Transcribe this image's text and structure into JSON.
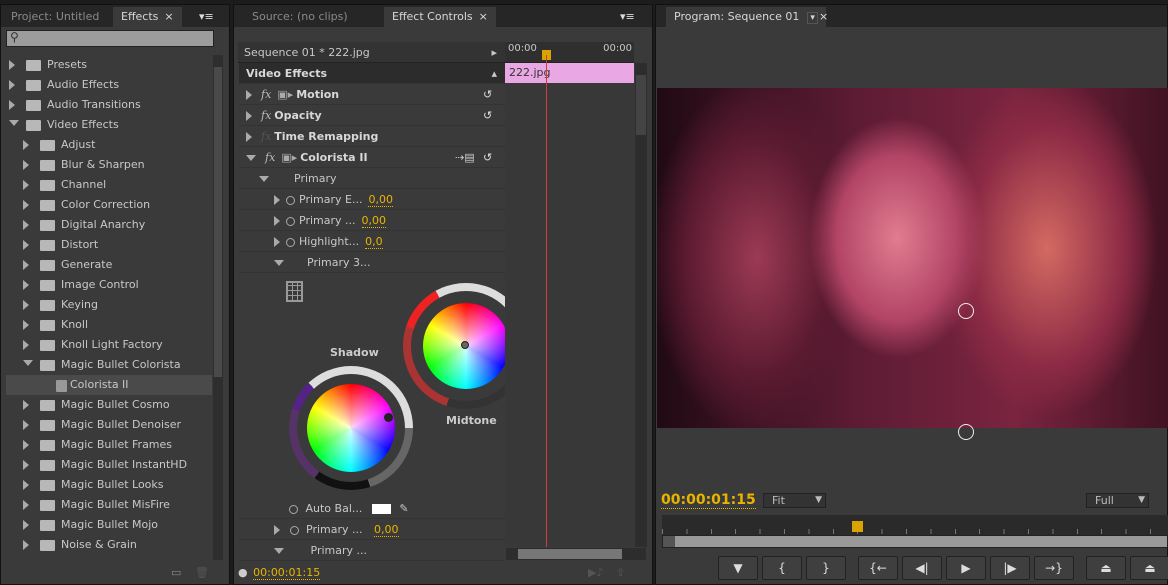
{
  "effects_panel": {
    "tabs": [
      {
        "label": "Project: Untitled"
      },
      {
        "label": "Effects",
        "close": "×"
      }
    ],
    "search_placeholder": "",
    "items": [
      {
        "label": "Presets",
        "level": 0,
        "open": false
      },
      {
        "label": "Audio Effects",
        "level": 0,
        "open": false
      },
      {
        "label": "Audio Transitions",
        "level": 0,
        "open": false
      },
      {
        "label": "Video Effects",
        "level": 0,
        "open": true
      },
      {
        "label": "Adjust",
        "level": 1
      },
      {
        "label": "Blur & Sharpen",
        "level": 1
      },
      {
        "label": "Channel",
        "level": 1
      },
      {
        "label": "Color Correction",
        "level": 1
      },
      {
        "label": "Digital Anarchy",
        "level": 1
      },
      {
        "label": "Distort",
        "level": 1
      },
      {
        "label": "Generate",
        "level": 1
      },
      {
        "label": "Image Control",
        "level": 1
      },
      {
        "label": "Keying",
        "level": 1
      },
      {
        "label": "Knoll",
        "level": 1
      },
      {
        "label": "Knoll Light Factory",
        "level": 1
      },
      {
        "label": "Magic Bullet Colorista",
        "level": 1,
        "open": true
      },
      {
        "label": "Colorista II",
        "level": 2,
        "selected": true
      },
      {
        "label": "Magic Bullet Cosmo",
        "level": 1
      },
      {
        "label": "Magic Bullet Denoiser",
        "level": 1
      },
      {
        "label": "Magic Bullet Frames",
        "level": 1
      },
      {
        "label": "Magic Bullet InstantHD",
        "level": 1
      },
      {
        "label": "Magic Bullet Looks",
        "level": 1
      },
      {
        "label": "Magic Bullet MisFire",
        "level": 1
      },
      {
        "label": "Magic Bullet Mojo",
        "level": 1
      },
      {
        "label": "Noise & Grain",
        "level": 1
      }
    ]
  },
  "effect_controls": {
    "tabs": [
      {
        "label": "Source: (no clips)"
      },
      {
        "label": "Effect Controls",
        "close": "×"
      }
    ],
    "sequence_label": "Sequence 01 * 222.jpg",
    "section_title": "Video Effects",
    "timeline_start": "00:00",
    "timeline_end": "00:00",
    "clip_label": "222.jpg",
    "clip_color": "#e9a8e4",
    "effects": [
      {
        "label": "Motion"
      },
      {
        "label": "Opacity"
      },
      {
        "label": "Time Remapping"
      },
      {
        "label": "Colorista II"
      }
    ],
    "primary_group": "Primary",
    "params": [
      {
        "label": "Primary E...",
        "value": "0,00"
      },
      {
        "label": "Primary ...",
        "value": "0,00"
      },
      {
        "label": "Highlight...",
        "value": "0,0"
      },
      {
        "label": "Primary 3..."
      }
    ],
    "wheels": {
      "shadow": "Shadow",
      "midtone": "Midtone"
    },
    "auto_balance_label": "Auto Bal...",
    "params_bottom": [
      {
        "label": "Primary ...",
        "value": "0,00"
      },
      {
        "label": "Primary ..."
      }
    ],
    "timecode": "00:00:01:15"
  },
  "program_monitor": {
    "tab": "Program: Sequence 01",
    "close": "×",
    "timecode": "00:00:01:15",
    "zoom_select": "Fit",
    "resolution_select": "Full",
    "accent": "#e8b400",
    "buttons": [
      "add-marker",
      "mark-in",
      "mark-out",
      "go-to-in",
      "step-back",
      "play",
      "step-forward",
      "go-to-out",
      "lift",
      "extract"
    ]
  }
}
